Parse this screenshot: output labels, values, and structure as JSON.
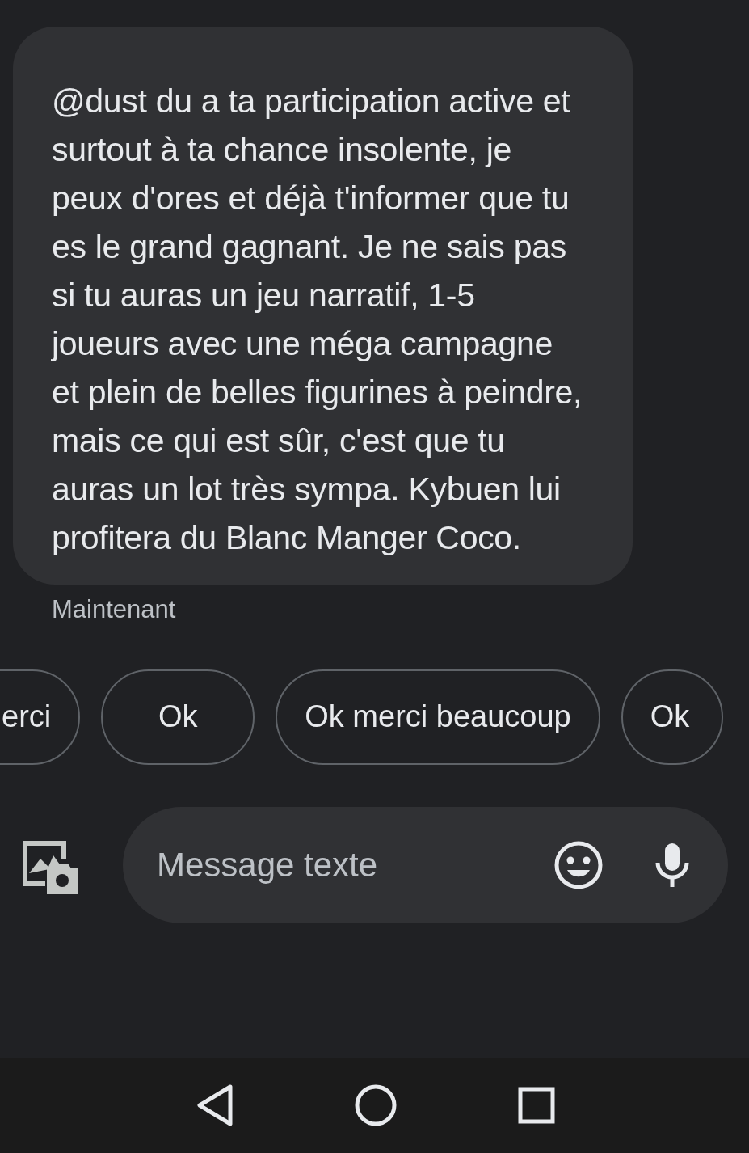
{
  "message": {
    "text": "@dust du a ta participation active et surtout à ta chance insolente, je peux d'ores et déjà t'informer que tu es le grand gagnant. Je ne sais pas si tu auras un jeu narratif, 1-5 joueurs avec une méga campagne et plein de belles figurines à peindre, mais ce qui est sûr, c'est que tu auras un lot très sympa. Kybuen lui profitera du Blanc Manger Coco.",
    "time": "Maintenant"
  },
  "suggestions": [
    "erci",
    "Ok",
    "Ok merci beaucoup",
    "Ok"
  ],
  "composer": {
    "placeholder": "Message texte"
  }
}
